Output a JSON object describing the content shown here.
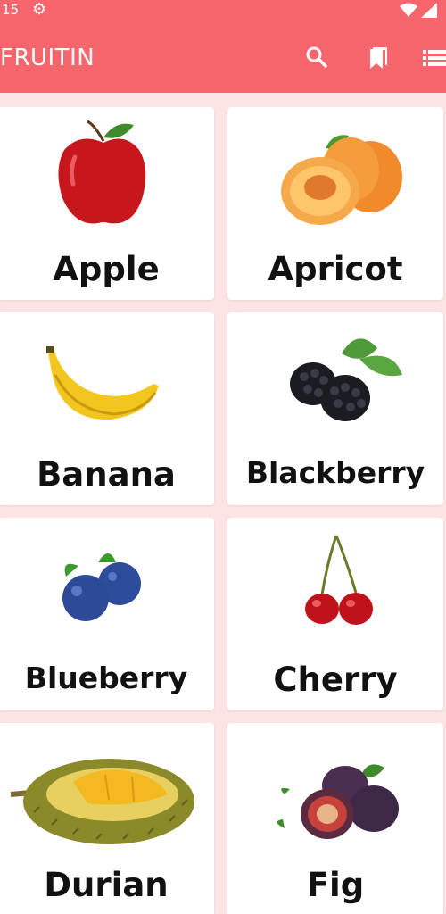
{
  "status_bar": {
    "time": "15"
  },
  "app_bar": {
    "title": "FRUITIN",
    "actions": [
      "search-icon",
      "bookmark-icon",
      "list-icon"
    ]
  },
  "fruits": [
    {
      "name": "Apple",
      "image": "apple"
    },
    {
      "name": "Apricot",
      "image": "apricot"
    },
    {
      "name": "Banana",
      "image": "banana"
    },
    {
      "name": "Blackberry",
      "image": "blackberry"
    },
    {
      "name": "Blueberry",
      "image": "blueberry"
    },
    {
      "name": "Cherry",
      "image": "cherry"
    },
    {
      "name": "Durian",
      "image": "durian"
    },
    {
      "name": "Fig",
      "image": "fig"
    }
  ],
  "colors": {
    "primary": "#f4656c",
    "background": "#fde3e4",
    "card": "#ffffff",
    "text": "#111111"
  }
}
